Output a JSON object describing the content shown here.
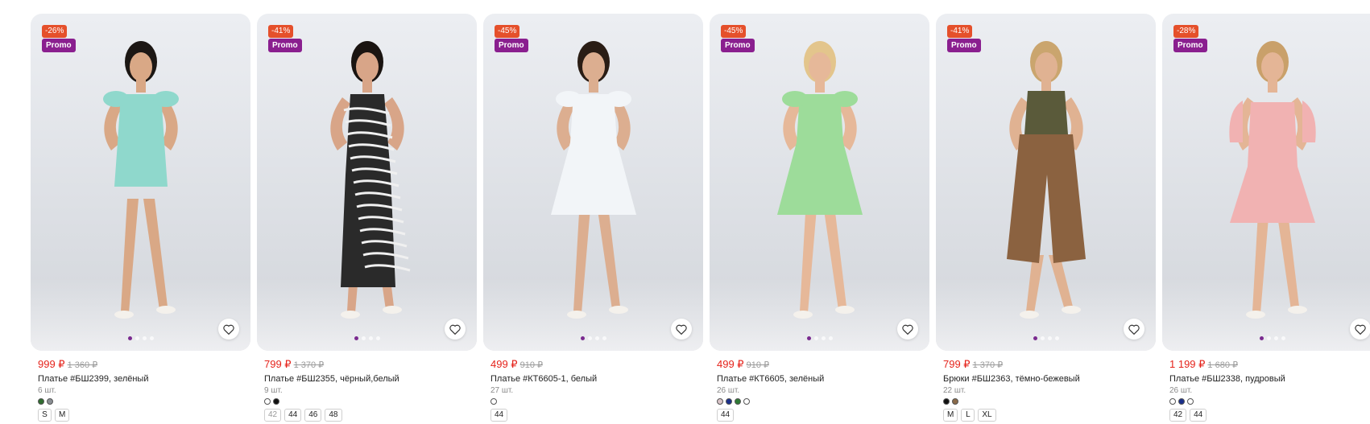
{
  "products": [
    {
      "discount": "-26%",
      "promo": "Promo",
      "price": "999 ₽",
      "old_price": "1 360 ₽",
      "name": "Платье #БШ2399, зелёный",
      "qty": "6 шт.",
      "colors": [
        "#2e6b2e",
        "#8a8f94"
      ],
      "sizes": [
        "S",
        "M"
      ],
      "dim_sizes": [],
      "dress_color": "#8fd8cc",
      "hair": "#1c1714",
      "skin": "#d9a886"
    },
    {
      "discount": "-41%",
      "promo": "Promo",
      "price": "799 ₽",
      "old_price": "1 370 ₽",
      "name": "Платье #БШ2355, чёрный,белый",
      "qty": "9 шт.",
      "colors": [
        "#ffffff",
        "#111111"
      ],
      "sizes": [
        "42",
        "44",
        "46",
        "48"
      ],
      "dim_sizes": [
        "42"
      ],
      "dress_color": "#2a2a2a",
      "hair": "#1a1411",
      "skin": "#d8a588"
    },
    {
      "discount": "-45%",
      "promo": "Promo",
      "price": "499 ₽",
      "old_price": "910 ₽",
      "name": "Платье #КТ6605-1, белый",
      "qty": "27 шт.",
      "colors": [
        "#ffffff"
      ],
      "sizes": [
        "44"
      ],
      "dim_sizes": [],
      "dress_color": "#f2f5f8",
      "hair": "#2a1d15",
      "skin": "#dcae90"
    },
    {
      "discount": "-45%",
      "promo": "Promo",
      "price": "499 ₽",
      "old_price": "910 ₽",
      "name": "Платье #КТ6605, зелёный",
      "qty": "26 шт.",
      "colors": [
        "#d9c4c8",
        "#1a2f8a",
        "#2e7a35",
        "#ffffff"
      ],
      "sizes": [
        "44"
      ],
      "dim_sizes": [],
      "dress_color": "#9ddc9a",
      "hair": "#e3c58c",
      "skin": "#e6b899"
    },
    {
      "discount": "-41%",
      "promo": "Promo",
      "price": "799 ₽",
      "old_price": "1 370 ₽",
      "name": "Брюки #БШ2363, тёмно-бежевый",
      "qty": "22 шт.",
      "colors": [
        "#111111",
        "#8a6a4a"
      ],
      "sizes": [
        "M",
        "L",
        "XL"
      ],
      "dim_sizes": [],
      "dress_color": "#8b6240",
      "top_color": "#5a5a3a",
      "hair": "#caa56e",
      "skin": "#e0b292"
    },
    {
      "discount": "-28%",
      "promo": "Promo",
      "price": "1 199 ₽",
      "old_price": "1 680 ₽",
      "name": "Платье #БШ2338, пудровый",
      "qty": "26 шт.",
      "colors": [
        "#ffffff",
        "#1a2f8a",
        "#ffffff"
      ],
      "sizes": [
        "42",
        "44"
      ],
      "dim_sizes": [],
      "dress_color": "#f1b2b2",
      "hair": "#c9a06a",
      "skin": "#e4b596"
    }
  ]
}
